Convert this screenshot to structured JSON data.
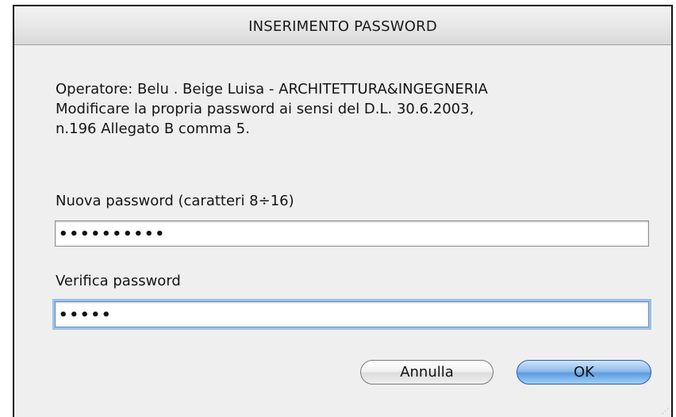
{
  "dialog": {
    "title": "INSERIMENTO PASSWORD",
    "message_lines": [
      "Operatore: Belu . Beige Luisa - ARCHITETTURA&INGEGNERIA",
      "Modificare la propria password ai sensi del D.L. 30.6.2003,",
      "n.196 Allegato B comma 5."
    ],
    "new_password": {
      "label": "Nuova password (caratteri 8÷16)",
      "value": "••••••••••"
    },
    "verify_password": {
      "label": "Verifica password",
      "value": "•••••"
    },
    "buttons": {
      "cancel_label": "Annulla",
      "ok_label": "OK"
    },
    "colors": {
      "dialog_background": "#efefef",
      "default_button": "#5d9be0",
      "focus_ring": "#9ec1ea"
    }
  }
}
